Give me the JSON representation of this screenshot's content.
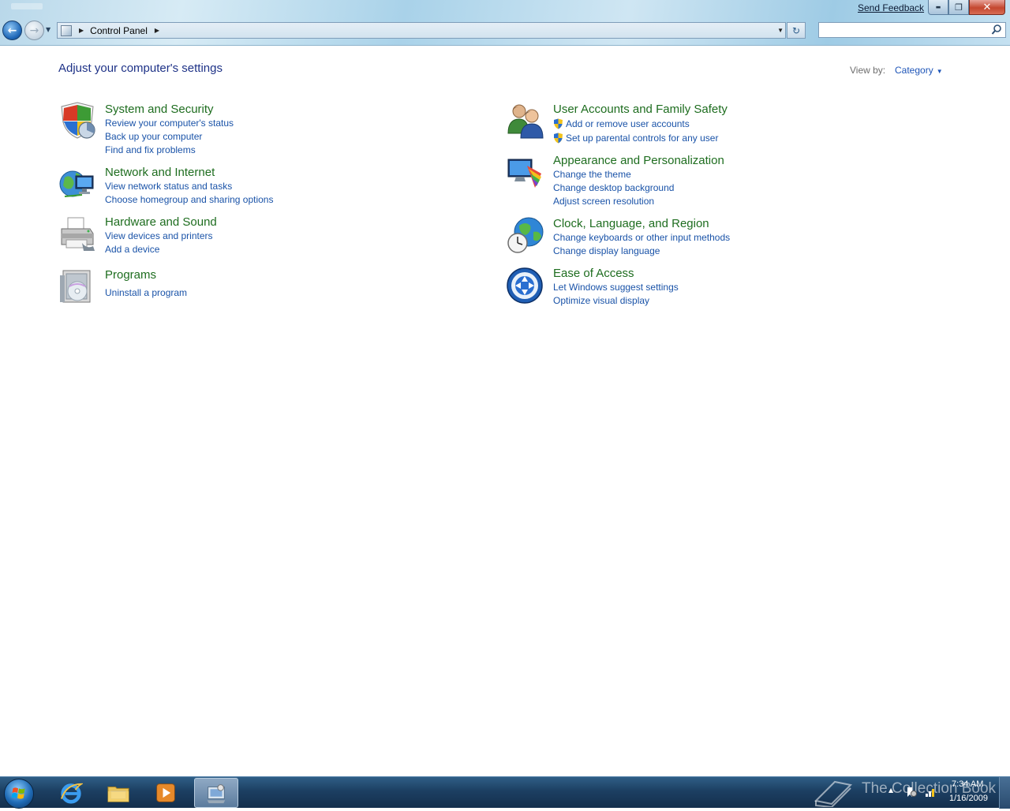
{
  "window": {
    "send_feedback": "Send Feedback",
    "minimize_glyph": "▬",
    "maximize_glyph": "❐",
    "close_glyph": "✕"
  },
  "nav": {
    "back_glyph": "←",
    "forward_glyph": "→",
    "history_glyph": "▼",
    "refresh_glyph": "↻"
  },
  "address": {
    "sep_glyph": "▶",
    "crumb": "Control Panel",
    "dropdown_glyph": "▼"
  },
  "search": {
    "value": "",
    "placeholder": ""
  },
  "content": {
    "title": "Adjust your computer's settings",
    "view_by_label": "View by:",
    "view_by_value": "Category",
    "view_by_arrow": "▼"
  },
  "categories": [
    {
      "title": "System and Security",
      "icon": "security-shield-icon",
      "links": [
        "Review your computer's status",
        "Back up your computer",
        "Find and fix problems"
      ]
    },
    {
      "title": "Network and Internet",
      "icon": "network-globe-icon",
      "links": [
        "View network status and tasks",
        "Choose homegroup and sharing options"
      ]
    },
    {
      "title": "Hardware and Sound",
      "icon": "printer-icon",
      "links": [
        "View devices and printers",
        "Add a device"
      ]
    },
    {
      "title": "Programs",
      "icon": "programs-disc-icon",
      "links": [
        "Uninstall a program"
      ]
    },
    {
      "title": "User Accounts and Family Safety",
      "icon": "users-icon",
      "links": [
        "Add or remove user accounts",
        "Set up parental controls for any user"
      ]
    },
    {
      "title": "Appearance and Personalization",
      "icon": "monitor-palette-icon",
      "links": [
        "Change the theme",
        "Change desktop background",
        "Adjust screen resolution"
      ]
    },
    {
      "title": "Clock, Language, and Region",
      "icon": "clock-globe-icon",
      "links": [
        "Change keyboards or other input methods",
        "Change display language"
      ]
    },
    {
      "title": "Ease of Access",
      "icon": "ease-of-access-icon",
      "links": [
        "Let Windows suggest settings",
        "Optimize visual display"
      ]
    }
  ],
  "taskbar": {
    "pinned": [
      "internet-explorer-icon",
      "windows-explorer-icon",
      "media-player-icon",
      "control-panel-icon"
    ],
    "watermark": "The Collection Book",
    "tray_arrow": "▲",
    "time": "7:34 AM",
    "date": "1/16/2009"
  },
  "colors": {
    "category_title": "#1e6d1f",
    "link": "#1a53a8",
    "page_title": "#1e3287"
  }
}
